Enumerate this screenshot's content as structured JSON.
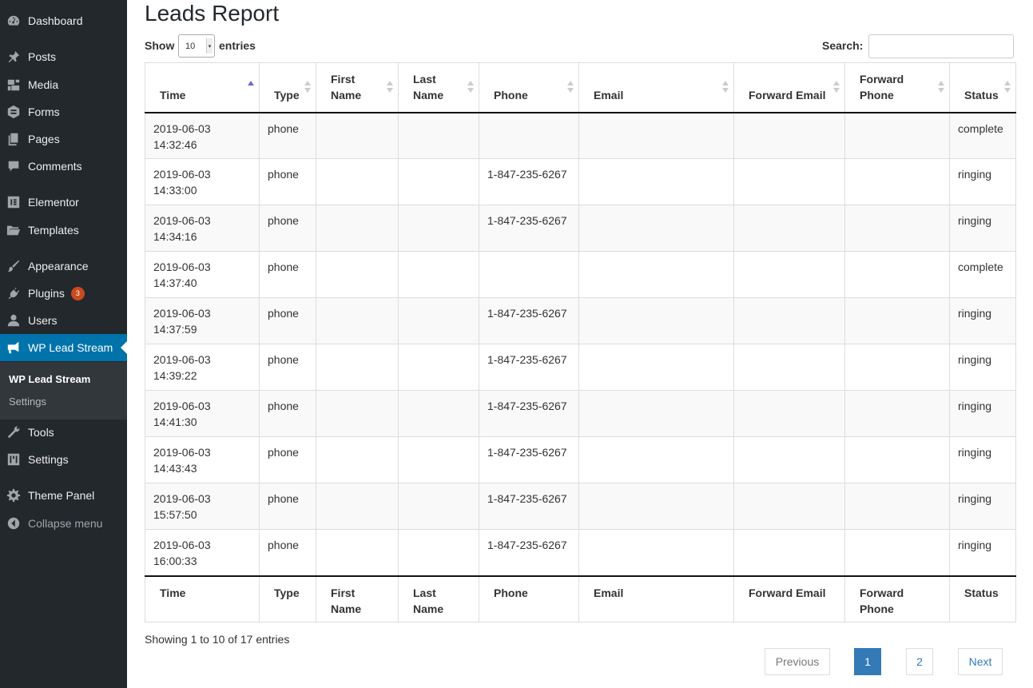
{
  "sidebar": {
    "items": [
      {
        "key": "dashboard",
        "label": "Dashboard",
        "icon": "dashboard-icon"
      },
      {
        "key": "posts",
        "label": "Posts",
        "icon": "pin-icon"
      },
      {
        "key": "media",
        "label": "Media",
        "icon": "media-icon"
      },
      {
        "key": "forms",
        "label": "Forms",
        "icon": "forms-icon"
      },
      {
        "key": "pages",
        "label": "Pages",
        "icon": "pages-icon"
      },
      {
        "key": "comments",
        "label": "Comments",
        "icon": "comment-icon"
      },
      {
        "key": "elementor",
        "label": "Elementor",
        "icon": "elementor-icon"
      },
      {
        "key": "templates",
        "label": "Templates",
        "icon": "folder-icon"
      },
      {
        "key": "appearance",
        "label": "Appearance",
        "icon": "brush-icon"
      },
      {
        "key": "plugins",
        "label": "Plugins",
        "icon": "plug-icon",
        "badge": "3"
      },
      {
        "key": "users",
        "label": "Users",
        "icon": "user-icon"
      },
      {
        "key": "wp-lead-stream",
        "label": "WP Lead Stream",
        "icon": "megaphone-icon"
      },
      {
        "key": "tools",
        "label": "Tools",
        "icon": "wrench-icon"
      },
      {
        "key": "settings",
        "label": "Settings",
        "icon": "settings-sliders-icon"
      },
      {
        "key": "theme-panel",
        "label": "Theme Panel",
        "icon": "gear-icon"
      },
      {
        "key": "collapse",
        "label": "Collapse menu",
        "icon": "collapse-arrow-icon"
      }
    ],
    "submenu": [
      {
        "label": "WP Lead Stream"
      },
      {
        "label": "Settings"
      }
    ]
  },
  "page": {
    "title": "Leads Report",
    "show_label": "Show",
    "entries_label": "entries",
    "page_length": "10",
    "search_label": "Search:",
    "search_value": ""
  },
  "table": {
    "columns": [
      "Time",
      "Type",
      "First Name",
      "Last Name",
      "Phone",
      "Email",
      "Forward Email",
      "Forward Phone",
      "Status"
    ],
    "header_lines": [
      [
        "Time"
      ],
      [
        "Type"
      ],
      [
        "First",
        "Name"
      ],
      [
        "Last",
        "Name"
      ],
      [
        "Phone"
      ],
      [
        "Email"
      ],
      [
        "Forward Email"
      ],
      [
        "Forward",
        "Phone"
      ],
      [
        "Status"
      ]
    ],
    "sorted_column": "Time",
    "sort_direction": "ascending",
    "rows": [
      {
        "date": "2019-06-03",
        "clock": "14:32:46",
        "type": "phone",
        "first": "",
        "last": "",
        "phone": "",
        "email": "",
        "fwd_email": "",
        "fwd_phone": "",
        "status": "complete"
      },
      {
        "date": "2019-06-03",
        "clock": "14:33:00",
        "type": "phone",
        "first": "",
        "last": "",
        "phone": "1-847-235-6267",
        "email": "",
        "fwd_email": "",
        "fwd_phone": "",
        "status": "ringing"
      },
      {
        "date": "2019-06-03",
        "clock": "14:34:16",
        "type": "phone",
        "first": "",
        "last": "",
        "phone": "1-847-235-6267",
        "email": "",
        "fwd_email": "",
        "fwd_phone": "",
        "status": "ringing"
      },
      {
        "date": "2019-06-03",
        "clock": "14:37:40",
        "type": "phone",
        "first": "",
        "last": "",
        "phone": "",
        "email": "",
        "fwd_email": "",
        "fwd_phone": "",
        "status": "complete"
      },
      {
        "date": "2019-06-03",
        "clock": "14:37:59",
        "type": "phone",
        "first": "",
        "last": "",
        "phone": "1-847-235-6267",
        "email": "",
        "fwd_email": "",
        "fwd_phone": "",
        "status": "ringing"
      },
      {
        "date": "2019-06-03",
        "clock": "14:39:22",
        "type": "phone",
        "first": "",
        "last": "",
        "phone": "1-847-235-6267",
        "email": "",
        "fwd_email": "",
        "fwd_phone": "",
        "status": "ringing"
      },
      {
        "date": "2019-06-03",
        "clock": "14:41:30",
        "type": "phone",
        "first": "",
        "last": "",
        "phone": "1-847-235-6267",
        "email": "",
        "fwd_email": "",
        "fwd_phone": "",
        "status": "ringing"
      },
      {
        "date": "2019-06-03",
        "clock": "14:43:43",
        "type": "phone",
        "first": "",
        "last": "",
        "phone": "1-847-235-6267",
        "email": "",
        "fwd_email": "",
        "fwd_phone": "",
        "status": "ringing"
      },
      {
        "date": "2019-06-03",
        "clock": "15:57:50",
        "type": "phone",
        "first": "",
        "last": "",
        "phone": "1-847-235-6267",
        "email": "",
        "fwd_email": "",
        "fwd_phone": "",
        "status": "ringing"
      },
      {
        "date": "2019-06-03",
        "clock": "16:00:33",
        "type": "phone",
        "first": "",
        "last": "",
        "phone": "1-847-235-6267",
        "email": "",
        "fwd_email": "",
        "fwd_phone": "",
        "status": "ringing"
      }
    ]
  },
  "footer": {
    "info": "Showing 1 to 10 of 17 entries",
    "previous": "Previous",
    "pages": [
      "1",
      "2"
    ],
    "current_page": "1",
    "next": "Next"
  },
  "colors": {
    "sidebar_bg": "#23282d",
    "active_bg": "#0073aa",
    "link": "#337ab7",
    "badge": "#ca4a1f"
  }
}
